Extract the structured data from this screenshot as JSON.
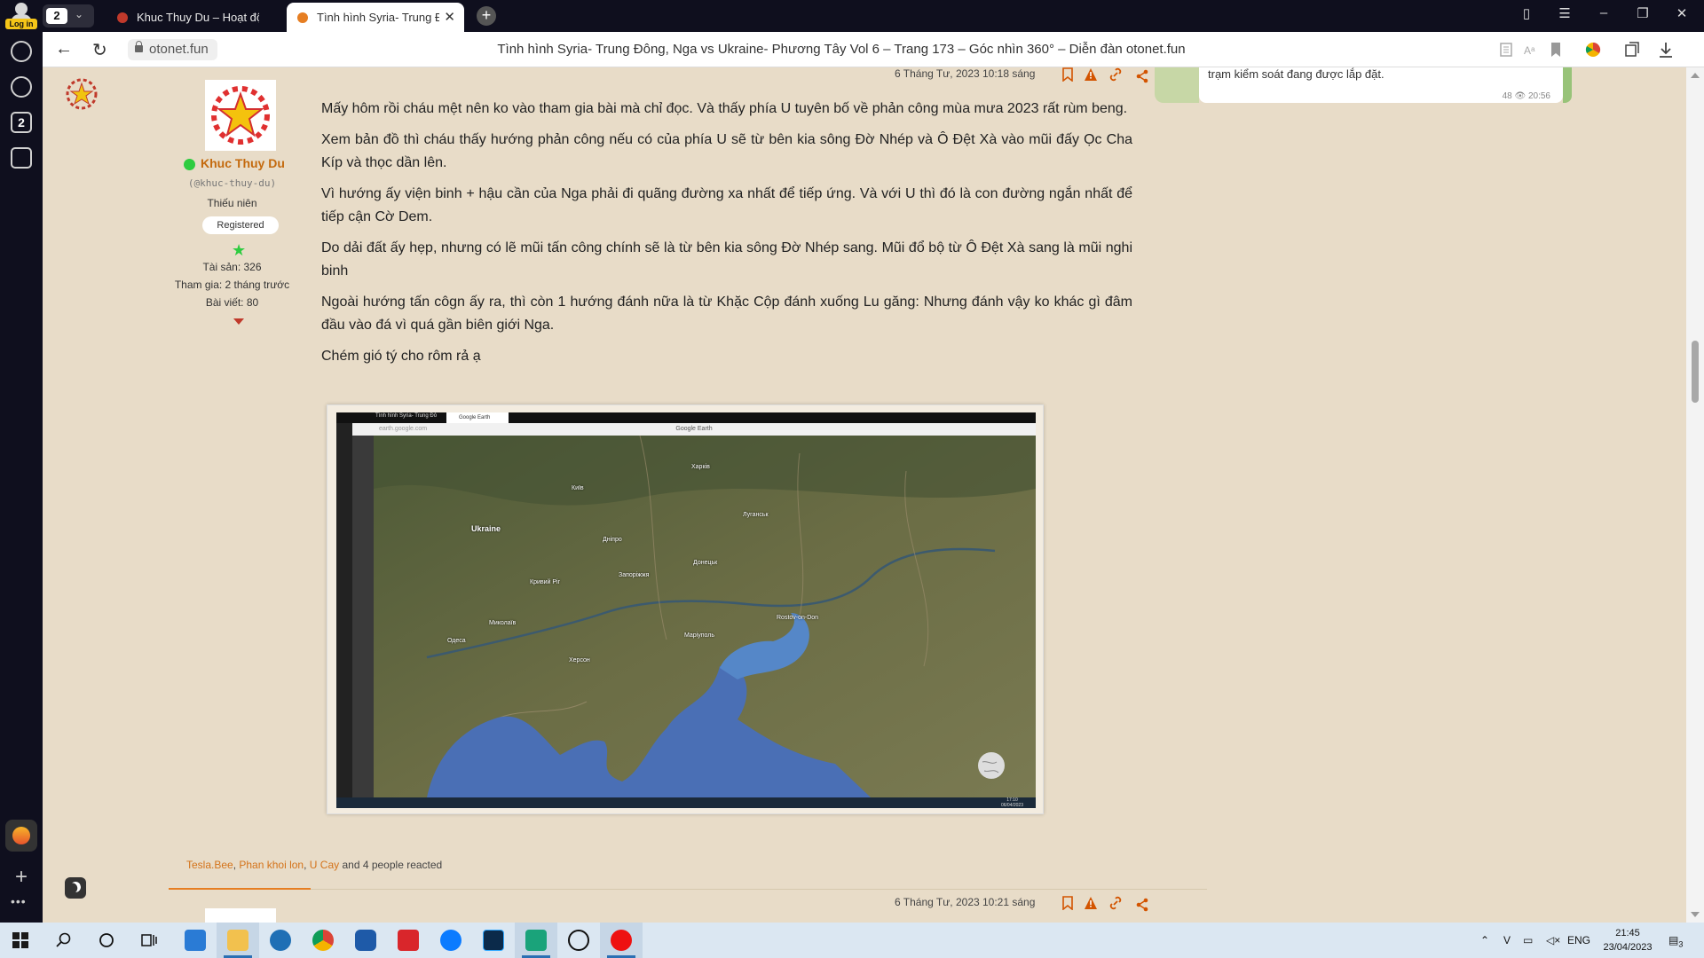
{
  "browser": {
    "profile_login_label": "Log in",
    "tab_group_count": "2",
    "tabs": [
      {
        "title": "Khuc Thuy Du – Hoạt động",
        "active": false
      },
      {
        "title": "Tình hình Syria- Trung Đ",
        "active": true
      }
    ],
    "url": "otonet.fun",
    "page_title": "Tình hình Syria- Trung Đông, Nga vs Ukraine- Phương Tây Vol 6 – Trang 173 – Góc nhìn 360° – Diễn đàn otonet.fun",
    "sidebar_badge": "2"
  },
  "post": {
    "date": "6 Tháng Tư, 2023 10:18 sáng",
    "user": {
      "name": "Khuc Thuy Du",
      "handle": "(@khuc-thuy-du)",
      "title": "Thiếu niên",
      "badge": "Registered",
      "assets": "Tài sản: 326",
      "joined": "Tham gia: 2 tháng trước",
      "posts": "Bài viết: 80"
    },
    "paragraphs": [
      "Mấy hôm rồi cháu mệt nên ko vào tham gia bài mà chỉ đọc. Và thấy phía U tuyên bố về phản công mùa mưa 2023 rất rùm beng.",
      "Xem bản đồ thì cháu thấy hướng phản công nếu có của phía U sẽ từ bên kia sông Đờ Nhép và Ô Đệt Xà vào mũi đấy Ọc Cha Kíp và thọc dần lên.",
      "Vì hướng ấy viện binh + hậu cần của Nga phải đi quãng đường xa nhất để tiếp ứng. Và với U thì đó là con đường ngắn nhất để tiếp cận Cờ Dem.",
      "Do dải đất ấy hẹp, nhưng có lẽ mũi tấn công chính sẽ là từ bên kia sông Đờ Nhép sang. Mũi đổ bộ từ Ô Đệt Xà sang là mũi nghi binh",
      "Ngoài hướng tấn côgn ấy ra, thì còn 1 hướng đánh nữa là từ Khặc Cộp đánh xuống Lu găng: Nhưng đánh vậy ko khác gì đâm đầu vào đá vì quá gần biên giới Nga.",
      "Chém gió tý cho rôm rả ạ"
    ],
    "screenshot": {
      "tab_1": "Tình hình Syria- Trung Đô",
      "tab_2": "Google Earth",
      "url": "earth.google.com",
      "title": "Google Earth",
      "map_label": "Ukraine",
      "map_places": [
        "Київ",
        "Дніпро",
        "Запоріжжя",
        "Маріуполь",
        "Харків",
        "Одеса",
        "Херсон",
        "Донецьк",
        "Луганськ",
        "Rostov-on-Don",
        "Кривий Ріг",
        "Миколаїв"
      ],
      "taskbar_time": "17:10",
      "taskbar_date": "06/04/2023"
    },
    "reactions": {
      "names": [
        "Tesla.Bee",
        "Phan khoi lon",
        "U Cay"
      ],
      "suffix": "and 4 people reacted"
    }
  },
  "next_post": {
    "date": "6 Tháng Tư, 2023 10:21 sáng"
  },
  "side_message": {
    "text": "trạm kiểm soát đang được lắp đặt.",
    "views": "48",
    "time": "20:56"
  },
  "taskbar": {
    "lang": "ENG",
    "time": "21:45",
    "date": "23/04/2023",
    "notif_count": "3",
    "apps": [
      "start",
      "search",
      "cortana",
      "task-view",
      "store",
      "file-explorer",
      "mail",
      "chrome",
      "pinned-app",
      "acrobat",
      "zalo",
      "photoshop",
      "wps",
      "browser-ghost",
      "yandex"
    ]
  },
  "colors": {
    "accent": "#e67e22",
    "username": "#c46a0e",
    "online": "#2ecc40",
    "page_bg": "#e8dcc8"
  }
}
